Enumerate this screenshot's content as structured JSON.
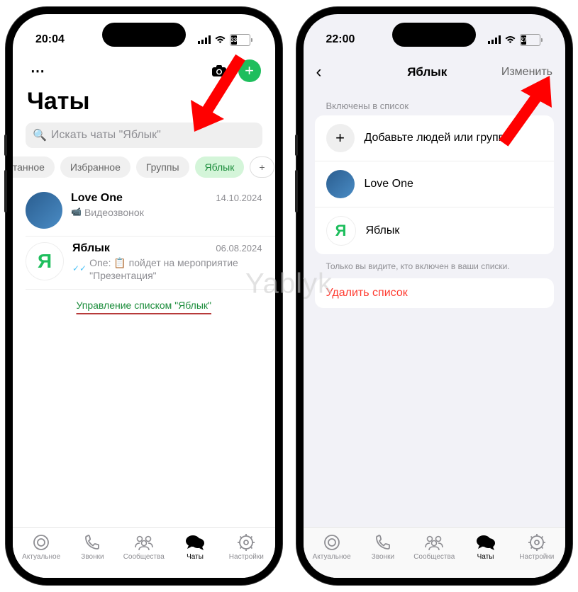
{
  "watermark": "Yablyk",
  "left": {
    "time": "20:04",
    "battery": "33",
    "battery_pct": 33,
    "title": "Чаты",
    "search_placeholder": "Искать чаты \"Яблык\"",
    "chips": [
      "итанное",
      "Избранное",
      "Группы",
      "Яблык",
      "+"
    ],
    "active_chip": "Яблык",
    "chats": [
      {
        "name": "Love One",
        "date": "14.10.2024",
        "sub": "Видеозвонок",
        "avatar": "blue"
      },
      {
        "name": "Яблык",
        "date": "06.08.2024",
        "sub": "One: 📋 пойдет на мероприятие \"Презентация\"",
        "avatar": "green",
        "avatar_text": "Я",
        "checks": true
      }
    ],
    "manage": "Управление списком \"Яблык\""
  },
  "right": {
    "time": "22:00",
    "battery": "27",
    "battery_pct": 27,
    "title": "Яблык",
    "edit": "Изменить",
    "section": "Включены в список",
    "rows": [
      {
        "icon": "plus",
        "text": "Добавьте людей или группы"
      },
      {
        "icon": "blue",
        "text": "Love One"
      },
      {
        "icon": "green",
        "text": "Яблык",
        "avatar_text": "Я"
      }
    ],
    "hint": "Только вы видите, кто включен в ваши списки.",
    "delete": "Удалить список"
  },
  "tabs": [
    {
      "label": "Актуальное",
      "icon": "updates"
    },
    {
      "label": "Звонки",
      "icon": "calls"
    },
    {
      "label": "Сообщества",
      "icon": "communities"
    },
    {
      "label": "Чаты",
      "icon": "chats",
      "active": true
    },
    {
      "label": "Настройки",
      "icon": "settings"
    }
  ]
}
